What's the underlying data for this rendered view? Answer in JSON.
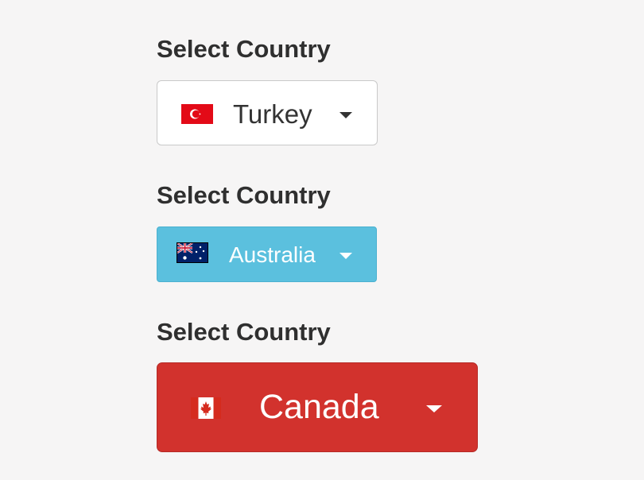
{
  "selects": [
    {
      "label": "Select Country",
      "value": "Turkey",
      "flag_icon": "turkey-flag-icon",
      "style": "default",
      "background": "#ffffff",
      "text_color": "#333333"
    },
    {
      "label": "Select Country",
      "value": "Australia",
      "flag_icon": "australia-flag-icon",
      "style": "info",
      "background": "#5bc0de",
      "text_color": "#ffffff"
    },
    {
      "label": "Select Country",
      "value": "Canada",
      "flag_icon": "canada-flag-icon",
      "style": "danger",
      "background": "#d2322d",
      "text_color": "#ffffff"
    }
  ]
}
